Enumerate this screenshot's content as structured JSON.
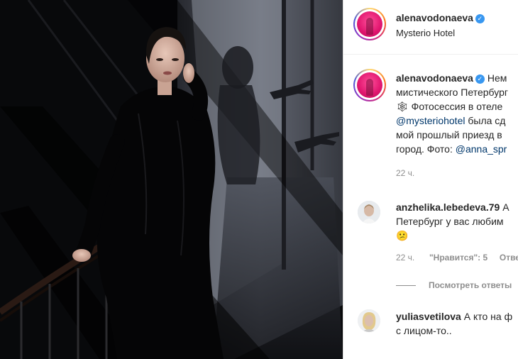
{
  "header": {
    "username": "alenavodonaeva",
    "location": "Mysterio Hotel"
  },
  "caption": {
    "username": "alenavodonaeva",
    "lines": [
      "Нем",
      "мистического Петербург",
      "Фотосессия в отеле",
      "была сд",
      "мой прошлый приезд в",
      "город. Фото: "
    ],
    "mention_hotel": "@mysteriohotel",
    "mention_photo": "@anna_spr",
    "emoji": "🕸",
    "time": "22 ч."
  },
  "comments": [
    {
      "username": "anzhelika.lebedeva.79",
      "text_tail": "А",
      "line2": "Петербург у вас любим",
      "emoji": "😕",
      "time": "22 ч.",
      "likes": "\"Нравится\": 5",
      "reply": "Отве",
      "view_replies": "Посмотреть ответы"
    },
    {
      "username": "yuliasvetilova",
      "text_tail": "А кто на ф",
      "line2": "с лицом-то..",
      "time": ""
    }
  ],
  "colors": {
    "verified": "#3897f0",
    "link": "#00376b",
    "muted": "#8e8e8e"
  }
}
